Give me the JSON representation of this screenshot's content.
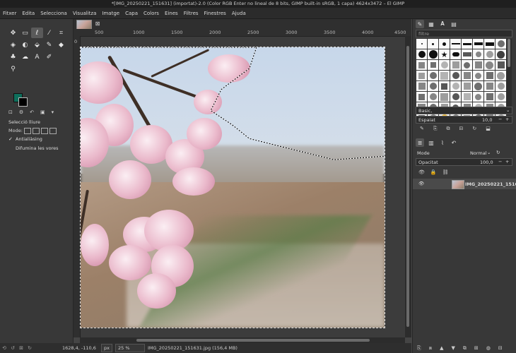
{
  "window": {
    "title": "*[IMG_20250221_151631] (importat)-2.0 (Color RGB Enter no lineal de 8 bits, GIMP built-in sRGB, 1 capa) 4624x3472 – El GIMP"
  },
  "menu": [
    "Fitxer",
    "Edita",
    "Selecciona",
    "Visualitza",
    "Imatge",
    "Capa",
    "Colors",
    "Eines",
    "Filtres",
    "Finestres",
    "Ajuda"
  ],
  "rulers": {
    "top": [
      "500",
      "1000",
      "1500",
      "2000",
      "2500",
      "3000",
      "3500",
      "4000",
      "4500"
    ],
    "left": [
      "0"
    ]
  },
  "tool_options": {
    "title": "Selecció lliure",
    "mode_label": "Mode:",
    "antialiasing": {
      "label": "Antialiàsing",
      "checked": true
    },
    "feather": {
      "label": "Difumina les vores",
      "checked": false
    }
  },
  "colors": {
    "foreground": "#0e6e5b",
    "background": "#000000"
  },
  "status": {
    "coords": "1628,4, -110,6",
    "unit": "px",
    "zoom": "25 %",
    "file": "IMG_20250221_151631.jpg (156,4 MB)"
  },
  "brushes_panel": {
    "filter_placeholder": "filtre",
    "preset": "Basic,",
    "spacing_label": "Espaiat",
    "spacing_value": "10,0"
  },
  "layers_panel": {
    "mode_label": "Mode",
    "mode_value": "Normal",
    "opacity_label": "Opacitat",
    "opacity_value": "100,0",
    "layers": [
      {
        "name": "IMG_20250221_1516"
      }
    ]
  }
}
